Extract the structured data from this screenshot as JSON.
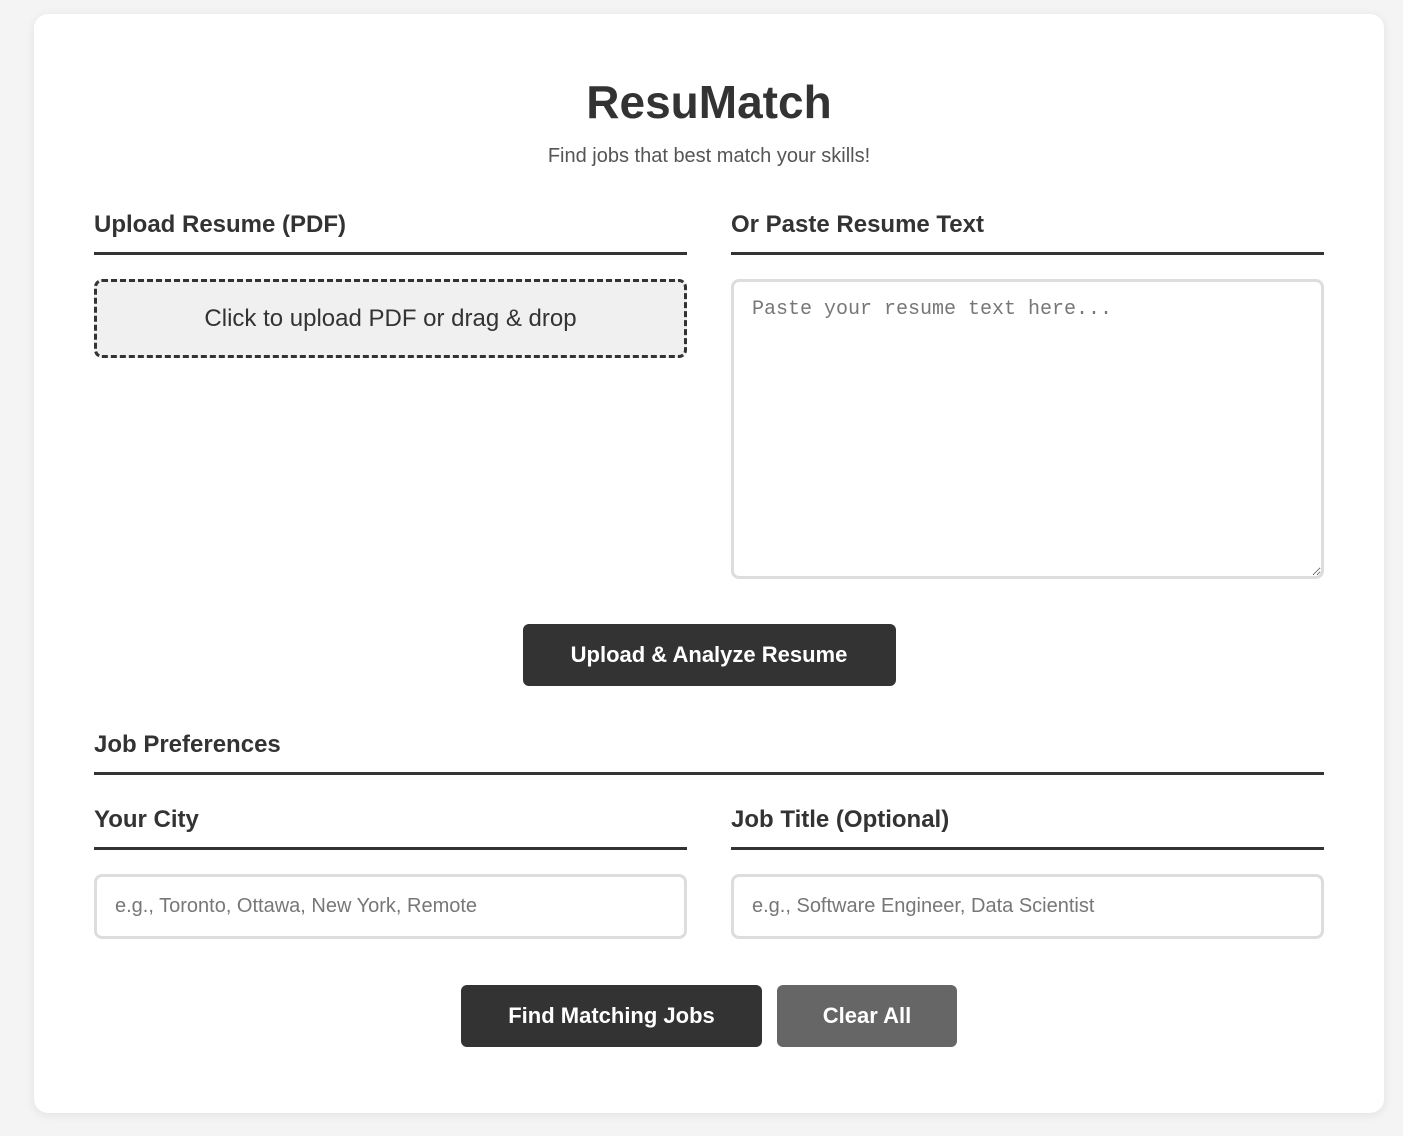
{
  "header": {
    "title": "ResuMatch",
    "subtitle": "Find jobs that best match your skills!"
  },
  "upload": {
    "heading": "Upload Resume (PDF)",
    "dropzone_label": "Click to upload PDF or drag & drop"
  },
  "paste": {
    "heading": "Or Paste Resume Text",
    "placeholder": "Paste your resume text here...",
    "value": ""
  },
  "analyze_button": "Upload & Analyze Resume",
  "preferences": {
    "heading": "Job Preferences",
    "city": {
      "label": "Your City",
      "placeholder": "e.g., Toronto, Ottawa, New York, Remote",
      "value": ""
    },
    "job_title": {
      "label": "Job Title (Optional)",
      "placeholder": "e.g., Software Engineer, Data Scientist",
      "value": ""
    }
  },
  "actions": {
    "find_label": "Find Matching Jobs",
    "clear_label": "Clear All"
  },
  "colors": {
    "primary_button": "#333333",
    "secondary_button": "#666666",
    "page_background": "#f4f4f4",
    "card_background": "#ffffff"
  }
}
